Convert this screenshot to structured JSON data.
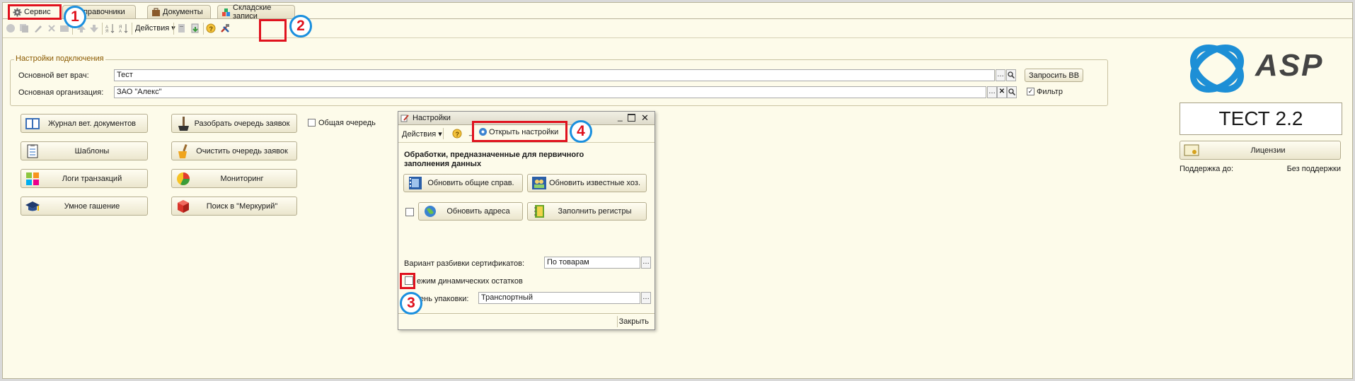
{
  "tabs": [
    {
      "label": "Сервис",
      "icon": "gear-icon"
    },
    {
      "label": "Справочники",
      "icon": "book-icon"
    },
    {
      "label": "Документы",
      "icon": "briefcase-icon"
    },
    {
      "label": "Складские записи",
      "icon": "blocks-icon"
    }
  ],
  "toolbar": {
    "actions_label": "Действия"
  },
  "connection": {
    "title": "Настройки подключения",
    "vet_label": "Основной вет врач:",
    "vet_value": "Тест",
    "org_label": "Основная организация:",
    "org_value": "ЗАО \"Алекс\"",
    "request_button": "Запросить ВВ",
    "filter_label": "Фильтр",
    "filter_checked": true
  },
  "main_buttons": {
    "journal": "Журнал вет. документов",
    "templates": "Шаблоны",
    "logs": "Логи транзакций",
    "smart": "Умное гашение",
    "parse_queue": "Разобрать очередь заявок",
    "clear_queue": "Очистить очередь заявок",
    "monitoring": "Мониторинг",
    "search_mercury": "Поиск в \"Меркурий\"",
    "common_queue": "Общая очередь"
  },
  "dialog": {
    "title": "Настройки",
    "actions_label": "Действия",
    "open_settings": "Открыть настройки",
    "section_title": "Обработки, предназначенные для первичного заполнения данных",
    "btn_update_common": "Обновить общие справ.",
    "btn_update_known": "Обновить известные хоз.",
    "btn_update_addresses": "Обновить адреса",
    "btn_fill_registers": "Заполнить регистры",
    "split_label": "Вариант разбивки сертификатов:",
    "split_value": "По товарам",
    "dynamic_label": "ежим динамических остатков",
    "pack_label": "ень упаковки:",
    "pack_value": "Транспортный",
    "close_label": "Закрыть"
  },
  "annotations": [
    "1",
    "2",
    "3",
    "4"
  ],
  "right_panel": {
    "logo_text": "ASP",
    "version": "ТЕСТ 2.2",
    "licenses_button": "Лицензии",
    "support_label": "Поддержка до:",
    "support_value": "Без поддержки"
  },
  "colors": {
    "background": "#fdfbea",
    "annotation_red": "#e0121e",
    "annotation_blue": "#1a8fde",
    "group_title": "#8b5a00"
  }
}
